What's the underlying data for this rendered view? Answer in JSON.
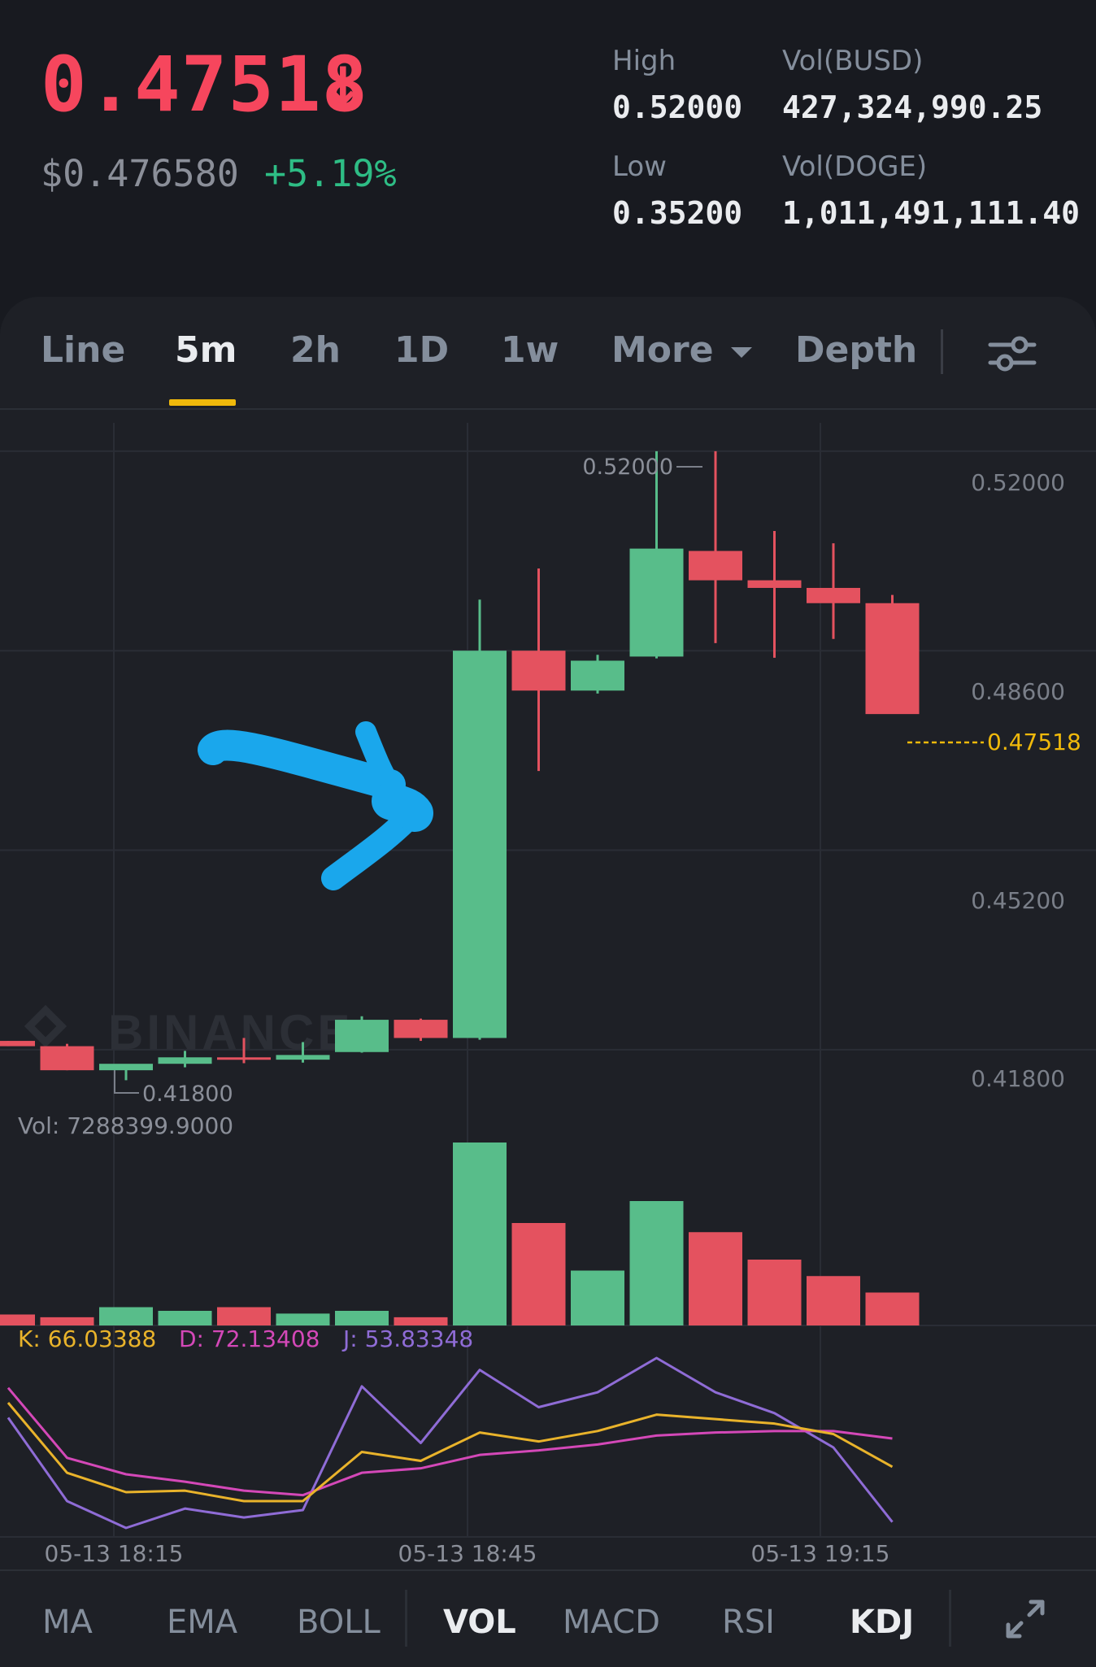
{
  "ticker": {
    "last_price": "0.47518",
    "last_price_arrow": "↓",
    "fiat_price": "$0.476580",
    "change_percent": "+5.19%",
    "high_label": "High",
    "high_value": "0.52000",
    "low_label": "Low",
    "low_value": "0.35200",
    "vol_busd_label": "Vol(BUSD)",
    "vol_busd_value": "427,324,990.25",
    "vol_doge_label": "Vol(DOGE)",
    "vol_doge_value": "1,011,491,111.40"
  },
  "tabs": {
    "line": "Line",
    "m5": "5m",
    "h2": "2h",
    "d1": "1D",
    "w1": "1w",
    "more": "More",
    "depth": "Depth"
  },
  "chart": {
    "watermark": "BINANCE",
    "y_ticks": [
      "0.52000",
      "0.48600",
      "0.45200",
      "0.41800"
    ],
    "max_label": "0.52000",
    "min_label": "0.41800",
    "current_price_label": "0.47518",
    "vol_label": "Vol: 7288399.9000",
    "kdj_k": "K: 66.03388",
    "kdj_d": "D: 72.13408",
    "kdj_j": "J: 53.83348",
    "x_ticks": [
      "05-13 18:15",
      "05-13 18:45",
      "05-13 19:15"
    ]
  },
  "chart_data": {
    "type": "candlestick",
    "ylim": [
      0.4105,
      0.5258
    ],
    "candles": [
      {
        "o": 0.4195,
        "h": 0.4195,
        "l": 0.4186,
        "c": 0.4186
      },
      {
        "o": 0.4186,
        "h": 0.419,
        "l": 0.4145,
        "c": 0.4145
      },
      {
        "o": 0.4145,
        "h": 0.4152,
        "l": 0.4128,
        "c": 0.4156
      },
      {
        "o": 0.4156,
        "h": 0.4178,
        "l": 0.415,
        "c": 0.4167
      },
      {
        "o": 0.4167,
        "h": 0.42,
        "l": 0.4157,
        "c": 0.4163
      },
      {
        "o": 0.4163,
        "h": 0.4193,
        "l": 0.4158,
        "c": 0.4171
      },
      {
        "o": 0.4176,
        "h": 0.4237,
        "l": 0.4175,
        "c": 0.4231
      },
      {
        "o": 0.4231,
        "h": 0.4233,
        "l": 0.4195,
        "c": 0.42
      },
      {
        "o": 0.42,
        "h": 0.4947,
        "l": 0.4197,
        "c": 0.486
      },
      {
        "o": 0.486,
        "h": 0.5,
        "l": 0.4655,
        "c": 0.4792
      },
      {
        "o": 0.4792,
        "h": 0.4853,
        "l": 0.4787,
        "c": 0.4843
      },
      {
        "o": 0.485,
        "h": 0.52,
        "l": 0.4847,
        "c": 0.5034
      },
      {
        "o": 0.503,
        "h": 0.52,
        "l": 0.4873,
        "c": 0.498
      },
      {
        "o": 0.498,
        "h": 0.5064,
        "l": 0.4848,
        "c": 0.4967
      },
      {
        "o": 0.4967,
        "h": 0.5043,
        "l": 0.488,
        "c": 0.4941
      },
      {
        "o": 0.4941,
        "h": 0.4955,
        "l": 0.478,
        "c": 0.4752
      }
    ],
    "volume": [
      0.6,
      0.45,
      1.0,
      0.8,
      1.0,
      0.65,
      0.8,
      0.45,
      10.0,
      5.6,
      3.0,
      6.8,
      5.1,
      3.6,
      2.7,
      1.8
    ],
    "kdj": {
      "K": [
        90,
        43,
        30,
        31,
        24,
        24,
        57,
        51,
        70,
        64,
        71,
        82,
        79,
        76,
        69,
        47
      ],
      "D": [
        100,
        53,
        42,
        37,
        31,
        28,
        43,
        46,
        55,
        58,
        62,
        68,
        70,
        71,
        71,
        66
      ],
      "J": [
        80,
        24,
        6,
        19,
        13,
        18,
        101,
        63,
        112,
        87,
        97,
        120,
        97,
        83,
        60,
        10
      ]
    },
    "x_tick_labels": [
      "05-13 18:15",
      "05-13 18:45",
      "05-13 19:15"
    ]
  },
  "indicators": {
    "ma": "MA",
    "ema": "EMA",
    "boll": "BOLL",
    "vol": "VOL",
    "macd": "MACD",
    "rsi": "RSI",
    "kdj": "KDJ"
  },
  "colors": {
    "up": "#58bd8a",
    "down": "#e4525f",
    "accent": "#f0b90b",
    "annotation": "#1aa7ec",
    "k_line": "#e9b32b",
    "d_line": "#d448b8",
    "j_line": "#8f6cd6"
  }
}
